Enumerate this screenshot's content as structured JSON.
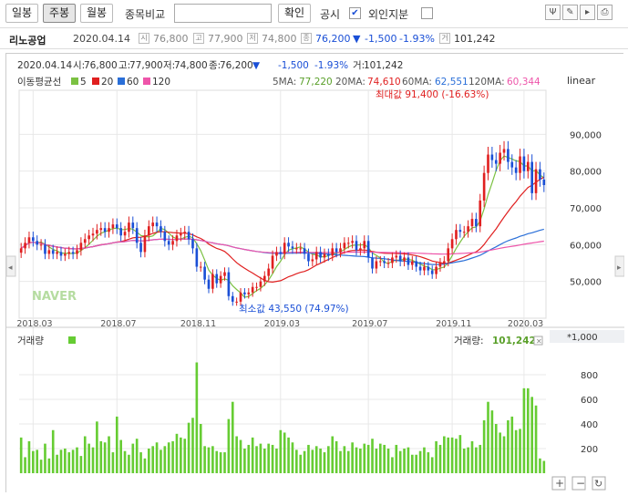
{
  "toolbar": {
    "btn_daily": "일봉",
    "btn_weekly": "주봉",
    "btn_monthly": "월봉",
    "compare_label": "종목비교",
    "confirm_btn": "확인",
    "disclosure_label": "공시",
    "foreign_label": "외인지분",
    "disclosure_checked": "✔"
  },
  "info": {
    "name": "리노공업",
    "date": "2020.04.14",
    "open": "76,800",
    "high": "77,900",
    "low": "74,800",
    "close": "76,200",
    "change_arrow": "▼",
    "change": "-1,500",
    "change_pct": "-1.93%",
    "volume": "101,242",
    "icon_open": "시",
    "icon_high": "고",
    "icon_low": "저",
    "icon_close": "종",
    "icon_volume": "거"
  },
  "ohlc_line": {
    "date": "2020.04.14",
    "open_label": "시:",
    "open": "76,800",
    "high_label": "고:",
    "high": "77,900",
    "low_label": "저:",
    "low": "74,800",
    "close_label": "종:",
    "close": "76,200",
    "change_arrow": "▼",
    "change": "-1,500",
    "change_pct": "-1.93%",
    "vol_label": "거:",
    "volume": "101,242"
  },
  "ma_legend": {
    "title": "이동평균선",
    "items": [
      {
        "label": "5",
        "color": "#7bc142"
      },
      {
        "label": "20",
        "color": "#e02020"
      },
      {
        "label": "60",
        "color": "#2a6fd8"
      },
      {
        "label": "120",
        "color": "#ee55aa"
      }
    ]
  },
  "ma_values": {
    "ma5_label": "5MA:",
    "ma5": "77,220",
    "ma20_label": "20MA:",
    "ma20": "74,610",
    "ma60_label": "60MA:",
    "ma60": "62,551",
    "ma120_label": "120MA:",
    "ma120": "60,344"
  },
  "scale_mode": "linear",
  "annotations": {
    "max": "최대값 91,400 (-16.63%)",
    "min": "최소값 43,550 (74.97%)",
    "watermark": "NAVER"
  },
  "volume_panel": {
    "title": "거래량",
    "label": "거래량:",
    "value": "101,242",
    "unit": "*1,000",
    "legend_color": "#66cc33"
  },
  "colors": {
    "up": "#e02020",
    "down": "#1a4fd6",
    "ma5": "#7bc142",
    "ma20": "#e02020",
    "ma60": "#2a6fd8",
    "ma120": "#ee55aa",
    "volume": "#66cc33",
    "grid": "#e8e8e8"
  },
  "chart_data": {
    "type": "candlestick",
    "period": "weekly",
    "x_ticks": [
      "2018.03",
      "2018.07",
      "2018.11",
      "2019.03",
      "2019.07",
      "2019.11",
      "2020.03"
    ],
    "x_tick_indices": [
      3,
      24,
      44,
      65,
      87,
      108,
      126
    ],
    "y_ticks": [
      50000,
      60000,
      70000,
      80000,
      90000
    ],
    "y_tick_labels": [
      "50,000",
      "60,000",
      "70,000",
      "80,000",
      "90,000"
    ],
    "ylim": [
      40000,
      100000
    ],
    "vol_ticks": [
      200,
      400,
      600,
      800
    ],
    "vol_ylim": [
      0,
      1000
    ],
    "close": [
      59000,
      60500,
      62000,
      61000,
      60000,
      60000,
      57500,
      58500,
      57500,
      58000,
      57000,
      57500,
      58000,
      57500,
      58500,
      60500,
      61500,
      62500,
      63000,
      64000,
      64500,
      63500,
      64500,
      65500,
      64500,
      62500,
      63500,
      66000,
      64500,
      60500,
      58000,
      62500,
      65000,
      66000,
      65000,
      63500,
      61000,
      60000,
      61000,
      62500,
      63000,
      63500,
      61500,
      59000,
      54000,
      54000,
      50500,
      48000,
      52000,
      49500,
      51500,
      52500,
      46000,
      44500,
      44500,
      47000,
      46500,
      47000,
      48500,
      48500,
      50000,
      51500,
      53500,
      57000,
      58000,
      57500,
      60500,
      59500,
      59000,
      59000,
      59000,
      57500,
      55500,
      56000,
      58000,
      56500,
      57500,
      57000,
      59000,
      58000,
      59000,
      60500,
      60500,
      61000,
      58500,
      59000,
      61000,
      56500,
      53500,
      55500,
      55500,
      55000,
      55000,
      56500,
      57000,
      55500,
      56500,
      54500,
      55500,
      54000,
      53000,
      54000,
      53000,
      52000,
      54000,
      55000,
      55500,
      59000,
      61500,
      64000,
      63500,
      63500,
      65000,
      67000,
      65000,
      72000,
      79500,
      84500,
      83000,
      82000,
      85000,
      86000,
      82500,
      81000,
      79500,
      84000,
      80000,
      82500,
      74000,
      80500,
      77700,
      76200
    ],
    "volume": [
      290,
      130,
      260,
      180,
      190,
      110,
      240,
      120,
      350,
      150,
      190,
      200,
      170,
      190,
      210,
      140,
      300,
      240,
      210,
      420,
      260,
      250,
      300,
      170,
      460,
      270,
      180,
      150,
      240,
      280,
      170,
      120,
      200,
      220,
      250,
      190,
      220,
      250,
      260,
      320,
      290,
      280,
      410,
      450,
      900,
      400,
      220,
      210,
      220,
      180,
      170,
      170,
      440,
      580,
      300,
      270,
      200,
      230,
      290,
      220,
      240,
      200,
      240,
      230,
      200,
      350,
      330,
      290,
      250,
      190,
      150,
      180,
      230,
      190,
      220,
      200,
      170,
      220,
      300,
      260,
      180,
      220,
      180,
      250,
      210,
      200,
      240,
      230,
      280,
      200,
      240,
      230,
      200,
      130,
      230,
      180,
      200,
      210,
      150,
      150,
      180,
      210,
      170,
      130,
      260,
      230,
      300,
      290,
      290,
      280,
      310,
      200,
      210,
      260,
      210,
      230,
      430,
      580,
      510,
      400,
      330,
      300,
      430,
      460,
      350,
      360,
      690,
      690,
      620,
      550,
      120,
      100
    ]
  }
}
